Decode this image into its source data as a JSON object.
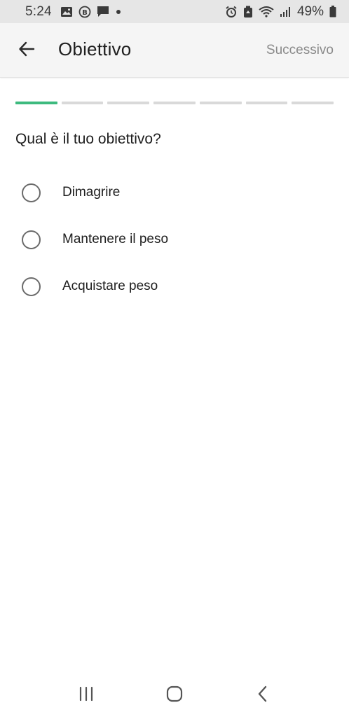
{
  "status_bar": {
    "time": "5:24",
    "battery_text": "49%",
    "icons_left": [
      "image-icon",
      "b-badge-icon",
      "message-icon",
      "dot-icon"
    ],
    "icons_right": [
      "alarm-icon",
      "recycle-icon",
      "wifi-icon",
      "signal-icon",
      "battery-icon"
    ]
  },
  "app_bar": {
    "title": "Obiettivo",
    "next_label": "Successivo"
  },
  "progress": {
    "total_steps": 7,
    "current_step": 1,
    "active_color": "#3dba7e",
    "inactive_color": "#d9d9d9"
  },
  "question": "Qual è il tuo obiettivo?",
  "options": [
    {
      "label": "Dimagrire",
      "selected": false
    },
    {
      "label": "Mantenere il peso",
      "selected": false
    },
    {
      "label": "Acquistare peso",
      "selected": false
    }
  ],
  "nav_bar": {
    "icons": [
      "recent-apps-icon",
      "home-icon",
      "back-nav-icon"
    ]
  }
}
